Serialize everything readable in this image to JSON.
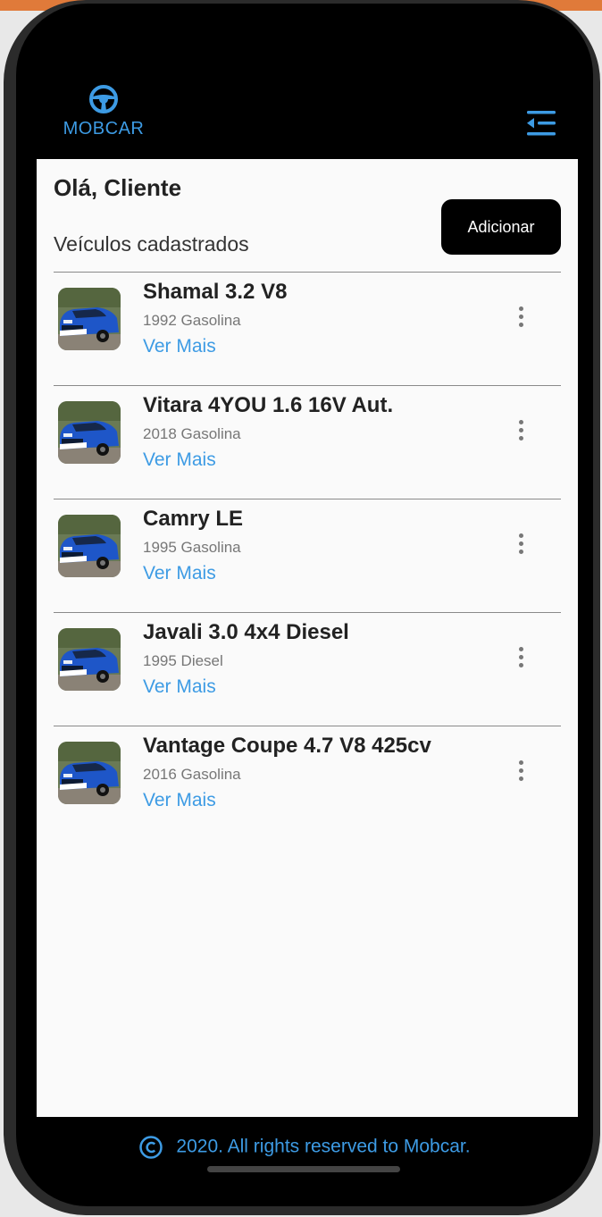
{
  "app": {
    "brand": "MOBCAR",
    "accent_color": "#3d9be4",
    "menu_icon": "menu-collapse-icon"
  },
  "main": {
    "greeting": "Olá, Cliente",
    "subtitle": "Veículos cadastrados",
    "add_label": "Adicionar",
    "vehicles": [
      {
        "name": "Shamal 3.2 V8",
        "meta": "1992 Gasolina",
        "link": "Ver Mais"
      },
      {
        "name": "Vitara 4YOU 1.6 16V Aut.",
        "meta": "2018 Gasolina",
        "link": "Ver Mais"
      },
      {
        "name": "Camry LE",
        "meta": "1995 Gasolina",
        "link": "Ver Mais"
      },
      {
        "name": "Javali 3.0 4x4 Diesel",
        "meta": "1995 Diesel",
        "link": "Ver Mais"
      },
      {
        "name": "Vantage Coupe 4.7 V8 425cv",
        "meta": "2016 Gasolina",
        "link": "Ver Mais"
      }
    ]
  },
  "footer": {
    "text": "2020. All rights reserved to Mobcar.",
    "icon": "copyright-icon"
  }
}
